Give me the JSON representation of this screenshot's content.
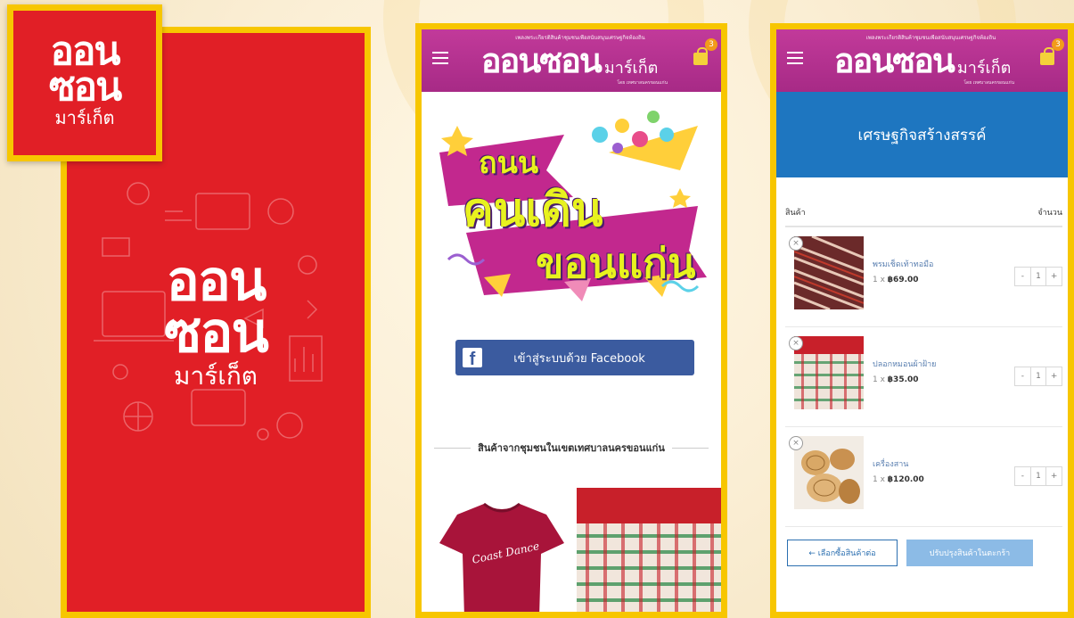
{
  "brand": {
    "line1": "ออน",
    "line2": "ซอน",
    "line3": "มาร์เก็ต"
  },
  "header": {
    "tagline": "เพลงพระเกียรติสินค้าชุมชนเพื่อสนับสนุนเศรษฐกิจท้องถิ่น",
    "logo_main": "ออนซอน",
    "logo_sub": "มาร์เก็ต",
    "byline": "โดย เทศบาลนครขอนแก่น",
    "cart_count": "3"
  },
  "home": {
    "banner": {
      "line1": "ถนน",
      "line2": "คนเดิน",
      "line3": "ขอนแก่น"
    },
    "facebook_label": "เข้าสู่ระบบด้วย Facebook",
    "section_title": "สินค้าจากชุมชนในเขตเทศบาลนครขอนแก่น",
    "shirt_text": "Coast Dance"
  },
  "cart": {
    "page_title": "เศรษฐกิจสร้างสรรค์",
    "col_product": "สินค้า",
    "col_qty": "จำนวน",
    "items": [
      {
        "name": "พรมเช็ดเท้าทอมือ",
        "qty_prefix": "1 x",
        "price": "฿69.00",
        "qty": "1"
      },
      {
        "name": "ปลอกหมอนผ้าฝ้าย",
        "qty_prefix": "1 x",
        "price": "฿35.00",
        "qty": "1"
      },
      {
        "name": "เครื่องสาน",
        "qty_prefix": "1 x",
        "price": "฿120.00",
        "qty": "1"
      }
    ],
    "continue_label": "← เลือกซื้อสินค้าต่อ",
    "update_label": "ปรับปรุงสินค้าในตะกร้า"
  },
  "colors": {
    "brand_red": "#e11f26",
    "frame_yellow": "#f7c600",
    "header_magenta": "#b1308f",
    "hero_blue": "#1e76c0",
    "facebook_blue": "#3b5b9f"
  }
}
